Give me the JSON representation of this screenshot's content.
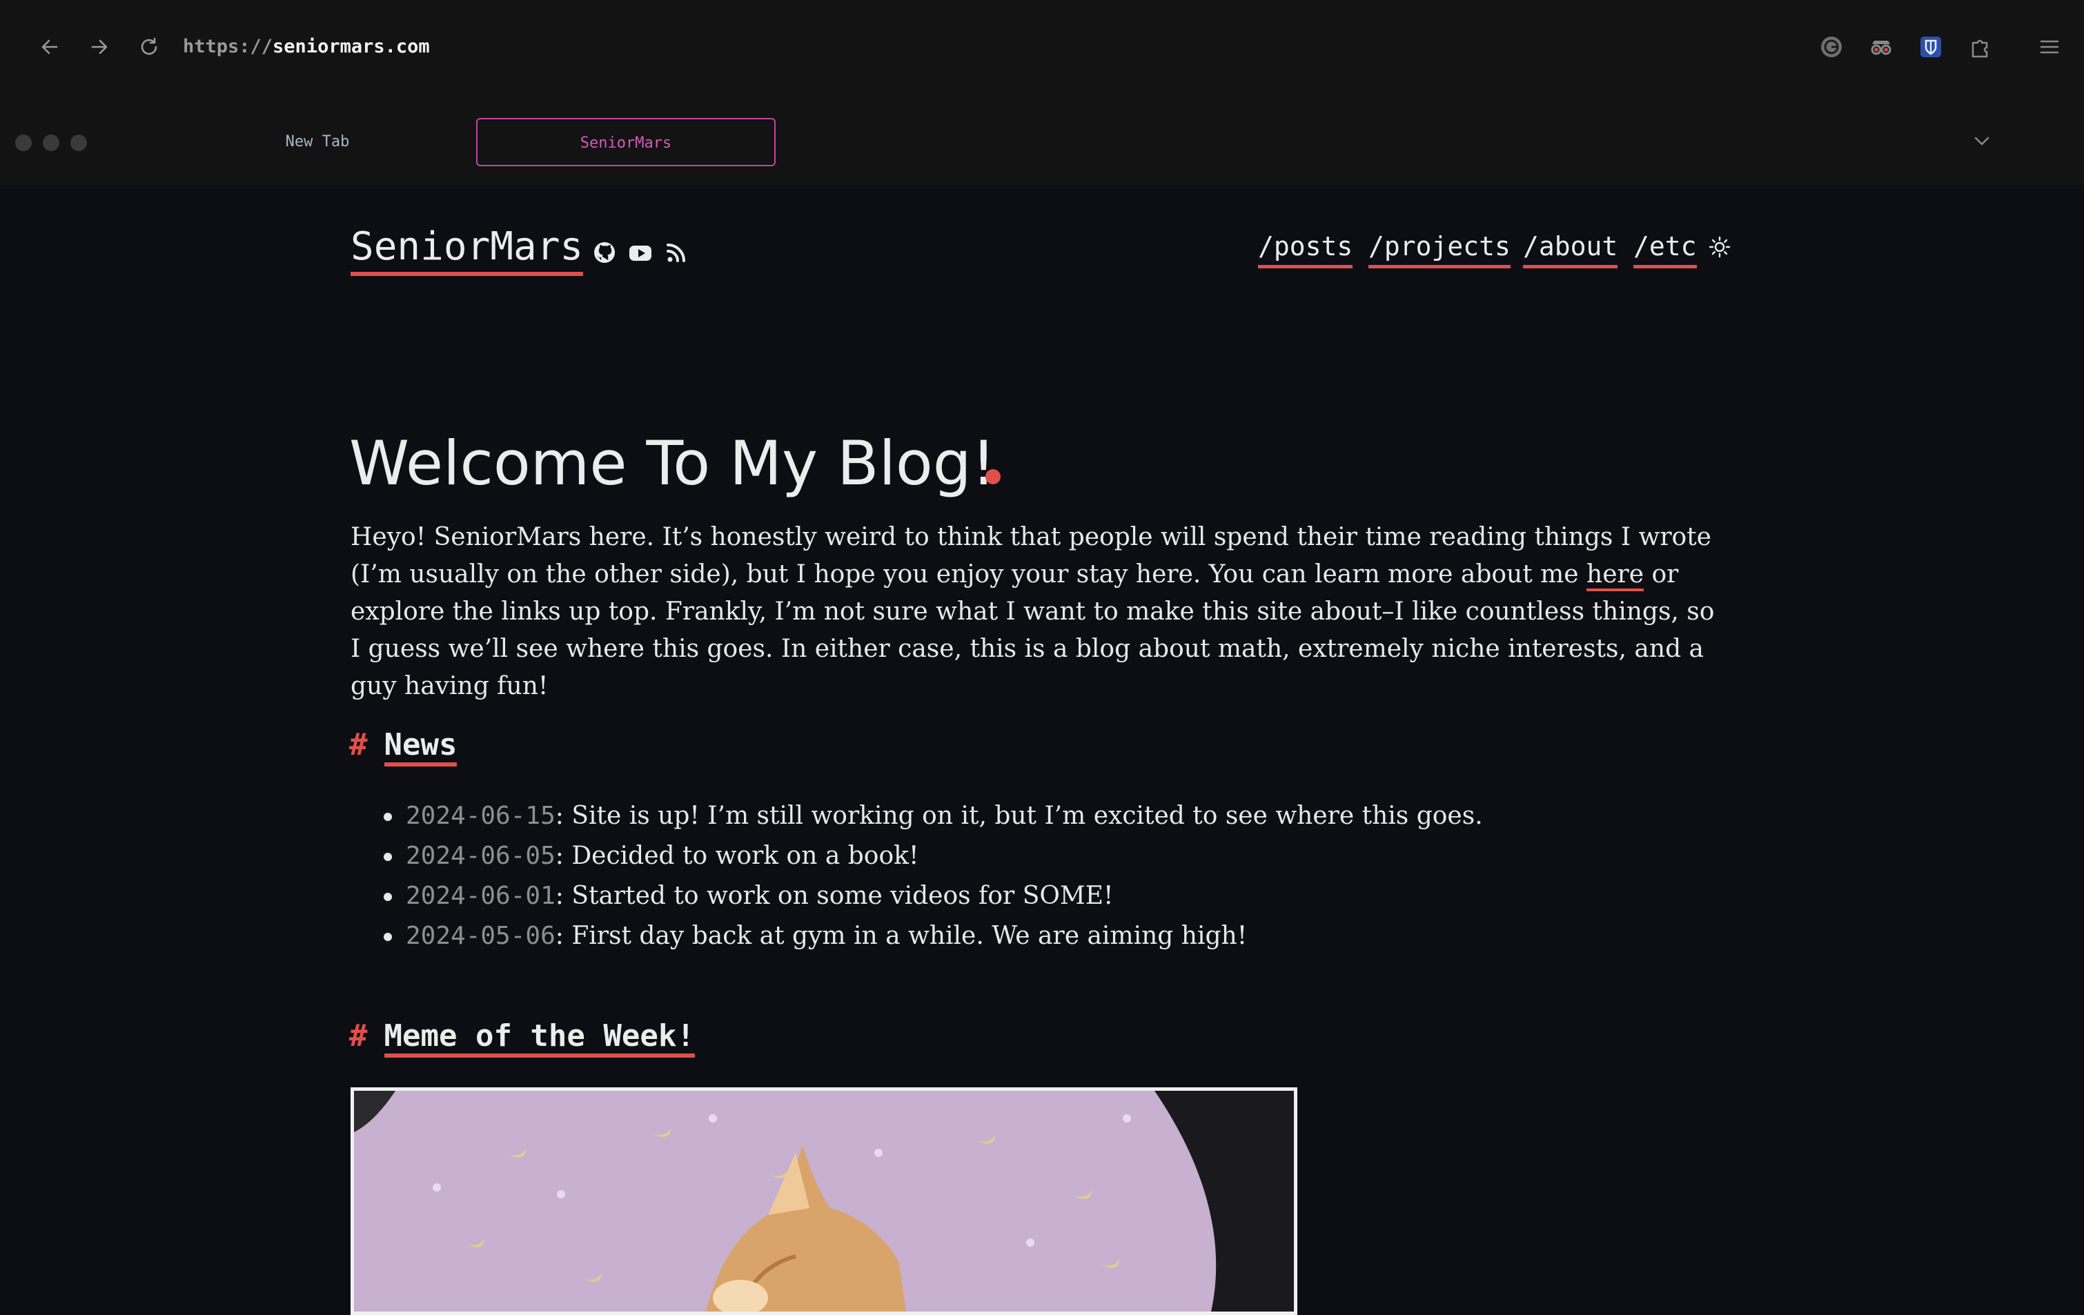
{
  "browser": {
    "url_scheme": "https://",
    "url_host": "seniormars.com",
    "tabs": [
      {
        "label": "New Tab",
        "active": false
      },
      {
        "label": "SeniorMars",
        "active": true
      }
    ],
    "icons": {
      "back": "arrow-left-icon",
      "forward": "arrow-right-icon",
      "reload": "reload-icon",
      "extensions": [
        "grammarly-icon",
        "spy-glasses-icon",
        "bitwarden-shield-icon",
        "puzzle-icon"
      ],
      "menu": "hamburger-menu-icon",
      "tab_list": "chevron-down-icon"
    }
  },
  "site": {
    "title": "SeniorMars",
    "social_icons": [
      "github-icon",
      "youtube-icon",
      "rss-icon"
    ],
    "nav": [
      "/posts",
      "/projects",
      "/about",
      "/etc"
    ],
    "theme_icon": "sun-icon",
    "accent_color": "#e0504a"
  },
  "hero": {
    "title": "Welcome To My Blog!",
    "intro_before": "Heyo! SeniorMars here. It’s honestly weird to think that people will spend their time reading things I wrote (I’m usually on the other side), but I hope you enjoy your stay here. You can learn more about me ",
    "intro_link": "here",
    "intro_after": " or explore the links up top. Frankly, I’m not sure what I want to make this site about–I like countless things, so I guess we’ll see where this goes. In either case, this is a blog about math, extremely niche interests, and a guy having fun!"
  },
  "news": {
    "hash": "#",
    "heading": "News",
    "items": [
      {
        "date": "2024-06-15",
        "text": ": Site is up! I’m still working on it, but I’m excited to see where this goes."
      },
      {
        "date": "2024-06-05",
        "text": ": Decided to work on a book!"
      },
      {
        "date": "2024-06-01",
        "text": ": Started to work on some videos for SOME!"
      },
      {
        "date": "2024-05-06",
        "text": ": First day back at gym in a while. We are aiming high!"
      }
    ]
  },
  "meme": {
    "hash": "#",
    "heading": "Meme of the Week!",
    "image_subject": "orange-cat-on-pink-pillow"
  }
}
